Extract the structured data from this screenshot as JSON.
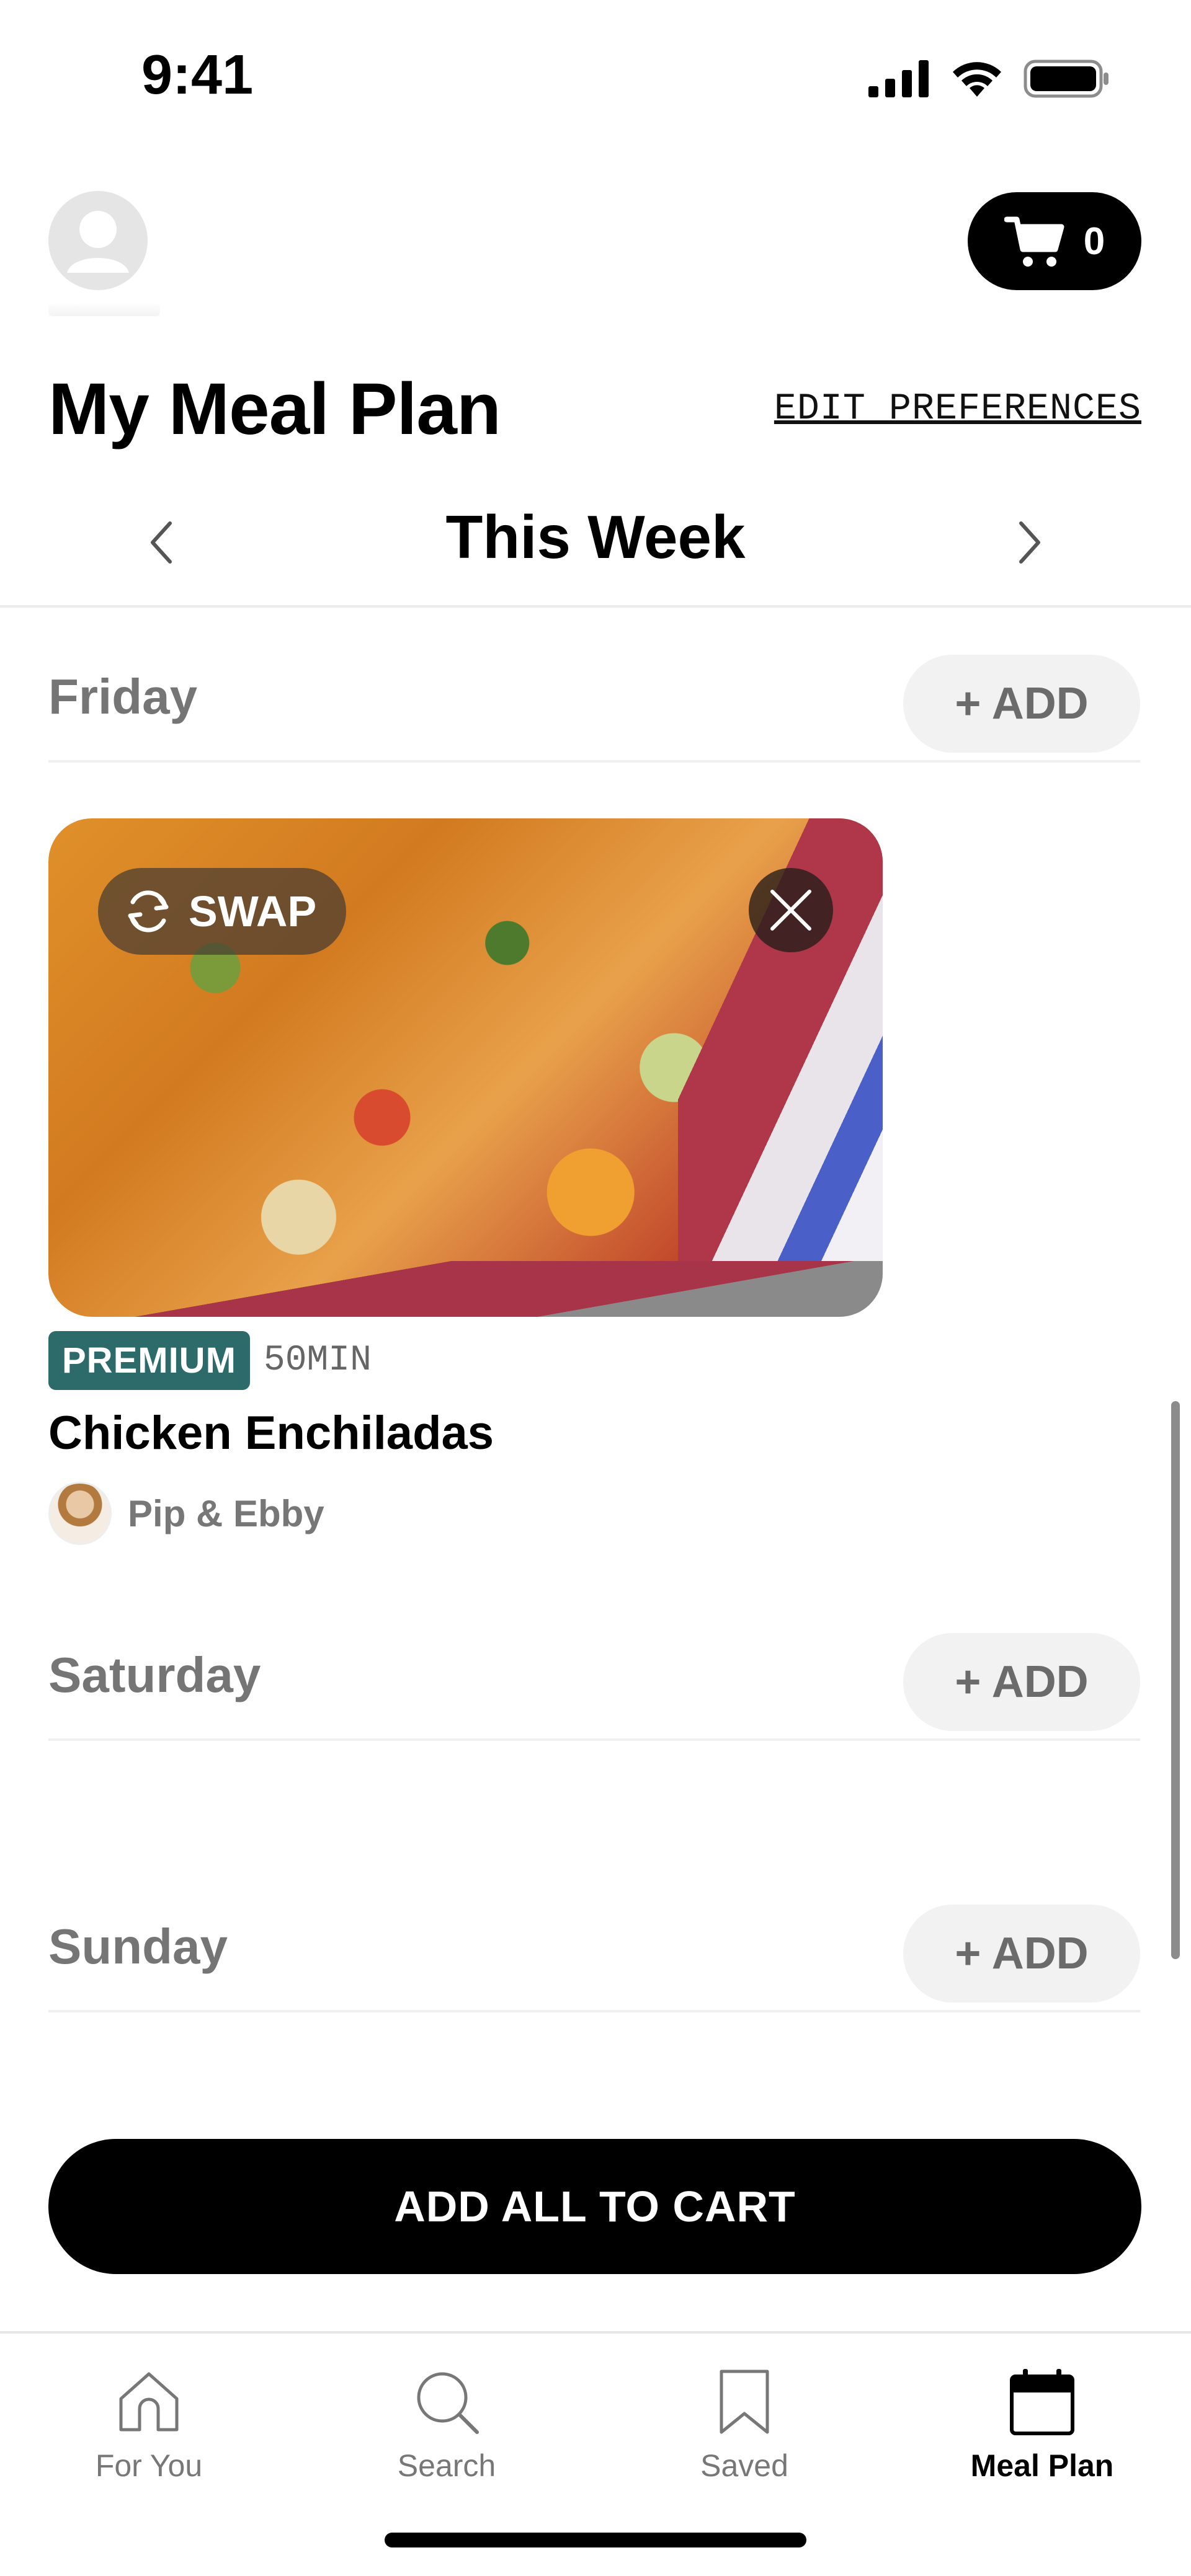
{
  "status_bar": {
    "time": "9:41"
  },
  "header": {
    "cart_count": "0",
    "title": "My Meal Plan",
    "edit_preferences": "EDIT PREFERENCES"
  },
  "week_nav": {
    "label": "This Week"
  },
  "days": [
    {
      "name": "Friday",
      "add_label": "+ ADD"
    },
    {
      "name": "Saturday",
      "add_label": "+ ADD"
    },
    {
      "name": "Sunday",
      "add_label": "+ ADD"
    }
  ],
  "recipe": {
    "swap_label": "SWAP",
    "badge": "PREMIUM",
    "duration": "50MIN",
    "title": "Chicken Enchiladas",
    "author": "Pip & Ebby"
  },
  "cta": {
    "add_all": "ADD ALL TO CART"
  },
  "tabs": [
    {
      "label": "For You",
      "icon": "home-icon",
      "active": false
    },
    {
      "label": "Search",
      "icon": "search-icon",
      "active": false
    },
    {
      "label": "Saved",
      "icon": "bookmark-icon",
      "active": false
    },
    {
      "label": "Meal Plan",
      "icon": "calendar-icon",
      "active": true
    }
  ],
  "colors": {
    "premium_badge": "#2d6b6b",
    "primary": "#000000",
    "muted_text": "#757575",
    "add_button_bg": "#f2f2f2"
  }
}
